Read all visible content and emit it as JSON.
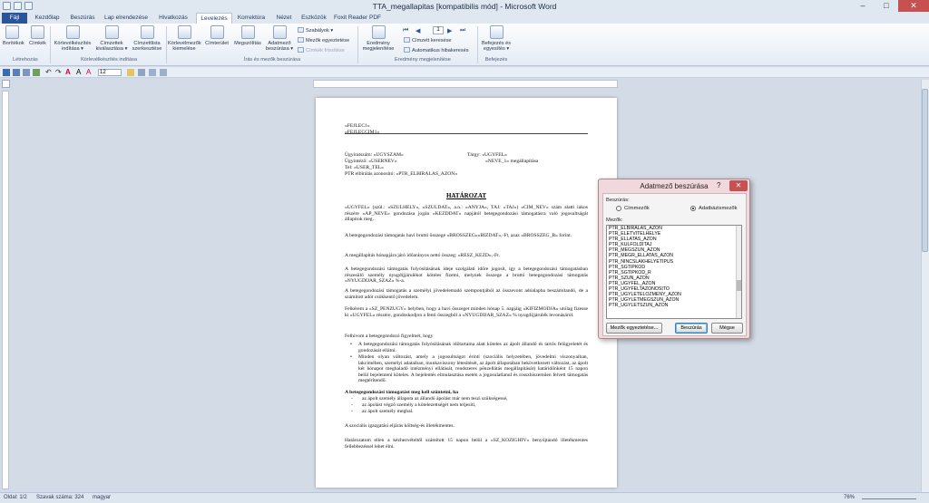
{
  "window": {
    "title": "TTA_megallapitas [kompatibilis mód] - Microsoft Word",
    "minimize": "–",
    "maximize": "□",
    "close": "✕"
  },
  "tabs": [
    "Fájl",
    "Kezdőlap",
    "Beszúrás",
    "Lap elrendezése",
    "Hivatkozás",
    "Levelezés",
    "Korrektúra",
    "Nézet",
    "Eszközök",
    "Foxit Reader PDF"
  ],
  "ribbon": {
    "buttons": {
      "borítekok": "Borítékok",
      "cimkek": "Címkék",
      "korlevel_inditasa": "Körlevélkészítés indítása ▾",
      "cimzettek_kivalasztasa": "Címzettek kiválasztása ▾",
      "cimzettlista": "Címzettlista szerkesztése",
      "korlevelmezok": "Körlevélmezők kiemelése",
      "cimterulet": "Címterület",
      "megszolitas": "Megszólítás",
      "adatmezo": "Adatmező beszúrása ▾",
      "eredmeny": "Eredmény megjelenítése",
      "befejezes": "Befejezés és egyesítés ▾"
    },
    "small": {
      "szabalyok": "Szabályok ▾",
      "mezok_egyeztetese": "Mezők egyeztetése",
      "cimkek_frissitese": "Címkék frissítése",
      "cimzett_keresese": "Címzett keresése",
      "automatikus_hiba": "Automatikus hibakeresés",
      "record": "1"
    },
    "groups": {
      "letrehozas": "Létrehozás",
      "korlevel": "Körlevélkészítés indítása",
      "iras": "Írás és mezők beszúrása",
      "eredmeny": "Eredmény megjelenítése",
      "befejezes": "Befejezés"
    }
  },
  "format": {
    "font_size": "12"
  },
  "document": {
    "fejlec": "«FEJLEC1»",
    "fejleccim": "«FEJLECCIM1»",
    "ugyiratszam": "Ügyiratszám: «UGYSZAM»",
    "ugyintezo": "Ügyintéző: «USERNEV»",
    "tel": "Tel: «USER_TEL»",
    "ptr": "PTR elbírálás azonosító: «PTR_ELBIRALAS_AZON»",
    "targy": "Tárgy: «UGYFEL»",
    "targy2": "«NEVE_1» megállapítása",
    "hatarozat": "HATÁROZAT",
    "p1": "«UGYFEL» (szül.: «SZULHELY», «SZULDAT», a.n.: «ANYJA», TAJ: «TAJ») «CIM_NEV» szám alatti lakos részére «AP_NEVE» gondozása jogán «KEZDDAT» napjától betegegondozási támogatásra való jogosultságát állapítok meg.",
    "p2": "A betegegondozási támogatás havi bruttó összege «BROSSZEG»«BIZDAT»,-Ft, azaz «BROSSZEG_B» forint.",
    "p3": "A megállapítás hónapjára járó időarányos nettó összeg: «RESZ_KEZD»,-Ft.",
    "p4": "A betegegondozási támogatás folyósításának ideje szolgálati időre jogosít, így a betegegondozási támogatásban részesülő személy nyugdíjjárulékot köteles fizetni, melynek összege a bruttó betegegondozási támogatás «NYUGDIJAR_SZAZ» %-a.",
    "p5": "A betegegondozási támogatás a személyi jövedelemadó szempontjából az összevont adóalapba beszámítandó, de a számított adót csökkentő jövedelem.",
    "p6": "Felkérem a «SZ_PENZUGY» helyben, hogy a havi összeget minden hónap 5. napjáig «KIFIZMODJA» utólag fizesse ki «UGYFEL» részére, gondoskodjon a fenti összegből a «NYUGDIJAR_SZAZ» % nyugdíjjárulék levonásáról.",
    "p7": "Felhívom a betegegondozó figyelmét, hogy",
    "b1": "A betegegondozási támogatás folyósításának időtartama alatt köteles az ápolt állandó és tartós felügyeletét és gondozását ellátni.",
    "b2": "Minden olyan változást, amely a jogosultságot érinti (szociális helyzetében, jövedelmi viszonyaiban, lakcímében, személyi adataiban, munkaviszony létesítését, az ápolt állapotában bekövetkezett változást, az ápolt két hónapot meghaladó intézményi ellátását, rendszeres pénzellátás megállapítását) határidőnként 15 napon belül bejelenteni köteles. A bejelentés elmulasztása esetén a jogosulatlanul és rosszhiszeműen felvett támogatás megtérítendő.",
    "p8": "A betegegondozási támogatást meg kell szüntetni, ha",
    "d1": "az ápolt személy állapota az állandó ápolást már nem teszi szükségessé,",
    "d2": "az ápolást végző személy a kötelezettségét nem teljesíti,",
    "d3": "az ápolt személy meghal.",
    "p9": "A szociális igazgatási eljárás költség-és illetékmentes.",
    "p10": "Határozatom ellen a kézhezvételtől számított 15 napon belül a «SZ_KOZIGHIV» benyújtandó illetékmentes fellebbezéssel lehet élni."
  },
  "dialog": {
    "title": "Adatmező beszúrása",
    "help": "?",
    "close": "✕",
    "beszuras_label": "Beszúrás:",
    "radio_cimmezok": "Címmezők",
    "radio_adatbazis": "Adatbázismezők",
    "mezok_label": "Mezők:",
    "fields": [
      "PTR_ELBIRALAS_AZON",
      "PTR_ELETVITELHELYE",
      "PTR_ELLATAS_AZON",
      "PTR_KULFOLDITAJ",
      "PTR_MEGSZUN_AZON",
      "PTR_MEGR_ELLATAS_AZON",
      "PTR_NINCSLAKHELYETIPUS",
      "PTR_SGTIPKOD",
      "PTR_SGTIPKOD_R",
      "PTR_SZUN_AZON",
      "PTR_UGYFEL_AZON",
      "PTR_UGYFELTAZONOSITO",
      "PTR_UGYLETELOZMENY_AZON",
      "PTR_UGYLETMEGSZUN_AZON",
      "PTR_UGYLETSZUN_AZON"
    ],
    "btn_mezok": "Mezők egyeztetése...",
    "btn_beszuras": "Beszúrás",
    "btn_megse": "Mégse"
  },
  "status": {
    "oldal": "Oldal: 1/2",
    "szavak": "Szavak száma: 324",
    "nyelv": "magyar",
    "zoom": "76%"
  }
}
